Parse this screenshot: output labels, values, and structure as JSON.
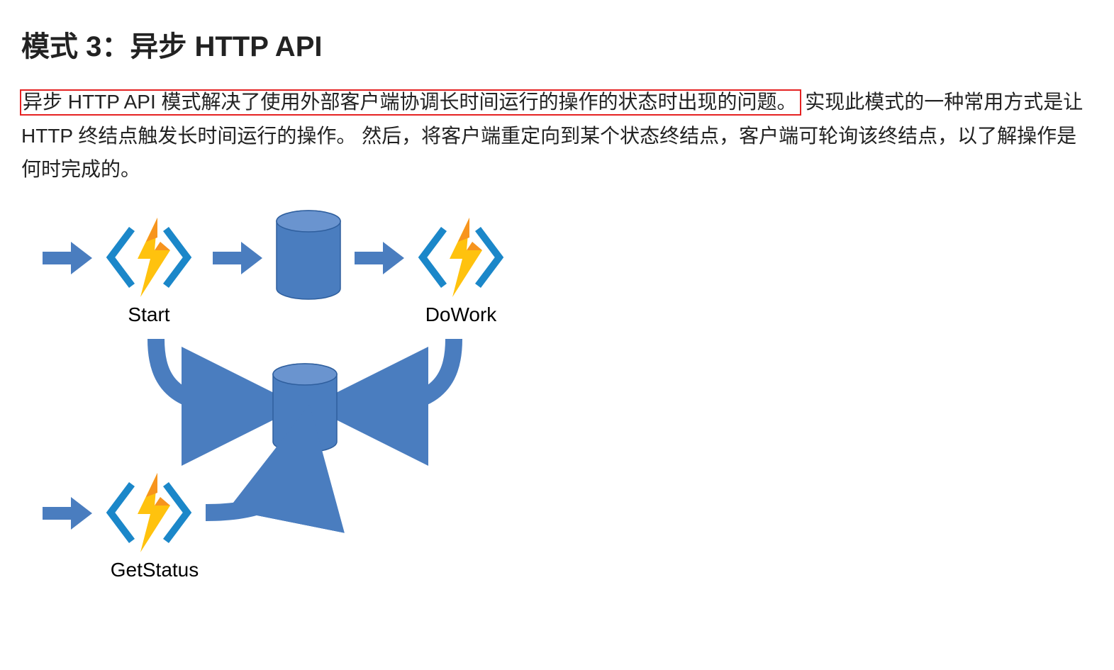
{
  "title": "模式 3：异步 HTTP API",
  "paragraph": {
    "highlighted": "异步 HTTP API 模式解决了使用外部客户端协调长时间运行的操作的状态时出现的问题。",
    "rest": " 实现此模式的一种常用方式是让 HTTP 终结点触发长时间运行的操作。 然后，将客户端重定向到某个状态终结点，客户端可轮询该终结点，以了解操作是何时完成的。"
  },
  "diagram": {
    "labels": {
      "start": "Start",
      "dowork": "DoWork",
      "getstatus": "GetStatus"
    },
    "colors": {
      "blue_fill": "#4a7dbf",
      "blue_stroke": "#2f5f9e",
      "bracket_stroke": "#1b87c9",
      "bolt_yellow": "#ffc20e",
      "bolt_orange": "#f7941e"
    }
  }
}
